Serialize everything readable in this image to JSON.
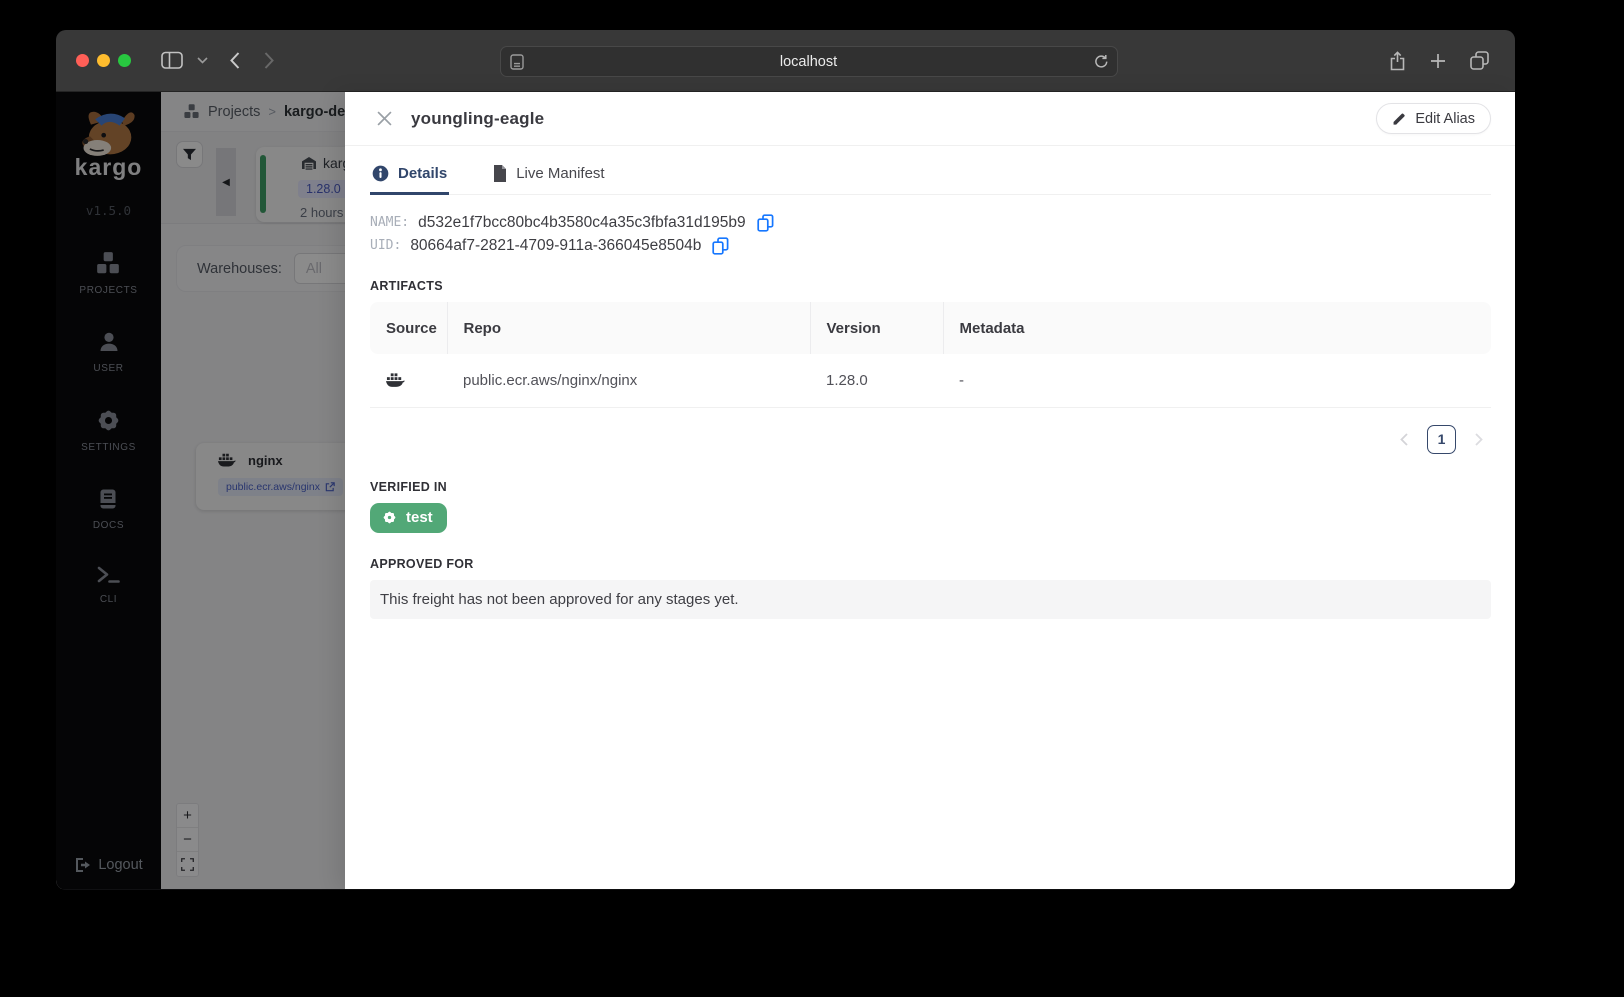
{
  "browser": {
    "url": "localhost",
    "traffic_lights": {
      "close": "#ff5f57",
      "minimize": "#febc2e",
      "zoom": "#28c840"
    }
  },
  "sidebar": {
    "logo_text": "kargo",
    "version": "v1.5.0",
    "items": [
      {
        "label": "PROJECTS",
        "icon": "boxes-icon"
      },
      {
        "label": "USER",
        "icon": "user-icon"
      },
      {
        "label": "SETTINGS",
        "icon": "gear-icon"
      },
      {
        "label": "DOCS",
        "icon": "book-icon"
      },
      {
        "label": "CLI",
        "icon": "terminal-icon"
      }
    ],
    "logout_label": "Logout"
  },
  "background": {
    "breadcrumb": {
      "root": "Projects",
      "separator": ">",
      "current": "kargo-demo"
    },
    "freight_card": {
      "title": "kargo-demo",
      "version": "1.28.0",
      "age": "2 hours"
    },
    "warehouses": {
      "label": "Warehouses:",
      "value": "All"
    },
    "node": {
      "title": "nginx",
      "repo_badge": "public.ecr.aws/nginx"
    },
    "zoom_controls": {
      "zoom_in": "+",
      "zoom_out": "−"
    }
  },
  "drawer": {
    "title": "youngling-eagle",
    "edit_alias_label": "Edit Alias",
    "tabs": [
      {
        "label": "Details",
        "active": true
      },
      {
        "label": "Live Manifest",
        "active": false
      }
    ],
    "meta": {
      "name_label": "NAME:",
      "name_value": "d532e1f7bcc80bc4b3580c4a35c3fbfa31d195b9",
      "uid_label": "UID:",
      "uid_value": "80664af7-2821-4709-911a-366045e8504b"
    },
    "artifacts": {
      "section_label": "ARTIFACTS",
      "columns": [
        "Source",
        "Repo",
        "Version",
        "Metadata"
      ],
      "rows": [
        {
          "source_icon": "docker-icon",
          "repo": "public.ecr.aws/nginx/nginx",
          "version": "1.28.0",
          "metadata": "-"
        }
      ],
      "page": "1"
    },
    "verified_in": {
      "label": "VERIFIED IN",
      "stage": "test",
      "stage_color": "#52a877"
    },
    "approved_for": {
      "label": "APPROVED FOR",
      "empty_text": "This freight has not been approved for any stages yet."
    }
  },
  "colors": {
    "accent_navy": "#31466b",
    "copy_blue": "#1677ff",
    "stage_green": "#52a877",
    "version_badge_blue": "#4b5cc4"
  }
}
